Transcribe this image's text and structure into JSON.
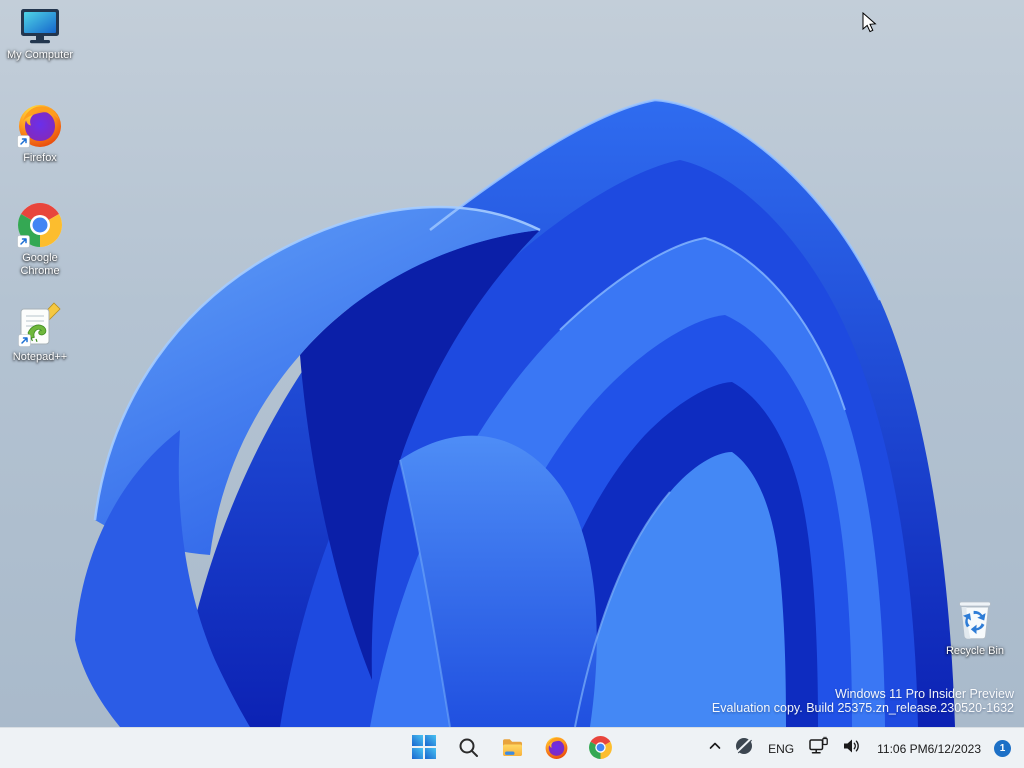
{
  "desktop": {
    "icons": [
      {
        "label": "My Computer",
        "icon": "monitor-icon",
        "shortcut": false
      },
      {
        "label": "Firefox",
        "icon": "firefox-icon",
        "shortcut": true
      },
      {
        "label": "Google Chrome",
        "icon": "chrome-icon",
        "shortcut": true
      },
      {
        "label": "Notepad++",
        "icon": "notepadpp-icon",
        "shortcut": true
      },
      {
        "label": "Recycle Bin",
        "icon": "recycle-bin-icon",
        "shortcut": false
      }
    ],
    "watermark": {
      "line1": "Windows 11 Pro Insider Preview",
      "line2": "Evaluation copy. Build 25375.zn_release.230520-1632"
    }
  },
  "taskbar": {
    "buttons": [
      {
        "name": "start",
        "icon": "windows-logo-icon"
      },
      {
        "name": "search",
        "icon": "search-icon"
      },
      {
        "name": "file-explorer",
        "icon": "folder-icon"
      },
      {
        "name": "firefox",
        "icon": "firefox-icon"
      },
      {
        "name": "chrome",
        "icon": "chrome-icon"
      }
    ],
    "tray": {
      "overflow_chevron": "chevron-up-icon",
      "no_internet": "globe-slash-icon",
      "language": "ENG",
      "network": "ethernet-monitor-icon",
      "volume": "speaker-icon",
      "clock": {
        "time": "11:06 PM",
        "date": "6/12/2023"
      },
      "notification_count": "1"
    }
  },
  "colors": {
    "sky_top": "#c3ced9",
    "sky_bottom": "#a8b9ca",
    "bloom_deep": "#0c22b4",
    "bloom_mid": "#2563eb",
    "bloom_light": "#61a0f8",
    "taskbar_bg": "#eef2f5",
    "badge_blue": "#1d70c6",
    "start_blue": "#2f7fd4"
  }
}
